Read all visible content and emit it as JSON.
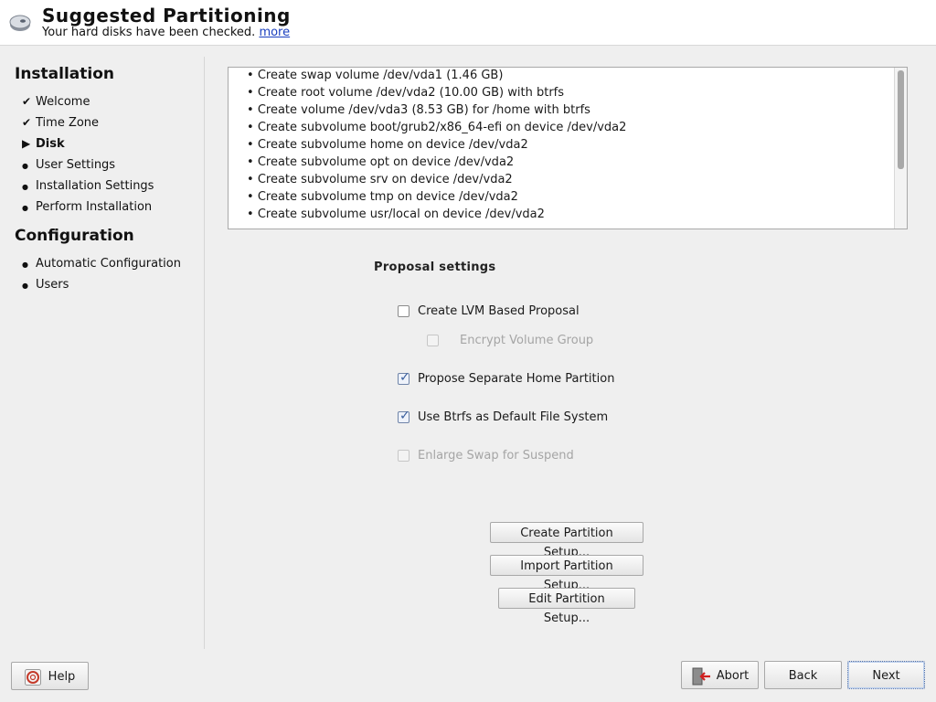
{
  "header": {
    "title": "Suggested Partitioning",
    "subtitle": "Your hard disks have been checked.",
    "more_link": "more",
    "icon": "disk-icon"
  },
  "sidebar": {
    "installation_title": "Installation",
    "installation_steps": [
      {
        "label": "Welcome",
        "status": "done"
      },
      {
        "label": "Time Zone",
        "status": "done"
      },
      {
        "label": "Disk",
        "status": "current"
      },
      {
        "label": "User Settings",
        "status": "pending"
      },
      {
        "label": "Installation Settings",
        "status": "pending"
      },
      {
        "label": "Perform Installation",
        "status": "pending"
      }
    ],
    "configuration_title": "Configuration",
    "configuration_steps": [
      {
        "label": "Automatic Configuration",
        "status": "pending"
      },
      {
        "label": "Users",
        "status": "pending"
      }
    ],
    "marks": {
      "done": "✔",
      "current": "▶",
      "pending": "●"
    }
  },
  "proposal_list": [
    "Create swap volume /dev/vda1 (1.46 GB)",
    "Create root volume /dev/vda2 (10.00 GB) with btrfs",
    "Create volume /dev/vda3 (8.53 GB) for /home with btrfs",
    "Create subvolume boot/grub2/x86_64-efi on device /dev/vda2",
    "Create subvolume home on device /dev/vda2",
    "Create subvolume opt on device /dev/vda2",
    "Create subvolume srv on device /dev/vda2",
    "Create subvolume tmp on device /dev/vda2",
    "Create subvolume usr/local on device /dev/vda2"
  ],
  "proposal_settings": {
    "title": "Proposal settings",
    "options": [
      {
        "label": "Create LVM Based Proposal",
        "checked": false,
        "disabled": false
      },
      {
        "label": "Encrypt Volume Group",
        "checked": false,
        "disabled": true
      },
      {
        "label": "Propose Separate Home Partition",
        "checked": true,
        "disabled": false
      },
      {
        "label": "Use Btrfs as Default File System",
        "checked": true,
        "disabled": false
      },
      {
        "label": "Enlarge Swap for Suspend",
        "checked": false,
        "disabled": true
      }
    ]
  },
  "actions": {
    "create": "Create Partition Setup...",
    "import": "Import Partition Setup...",
    "edit": "Edit Partition Setup..."
  },
  "footer": {
    "help": "Help",
    "abort": "Abort",
    "back": "Back",
    "next": "Next"
  },
  "colors": {
    "accent": "#3a5f9e",
    "link": "#1a3fbf",
    "background": "#efefef"
  }
}
